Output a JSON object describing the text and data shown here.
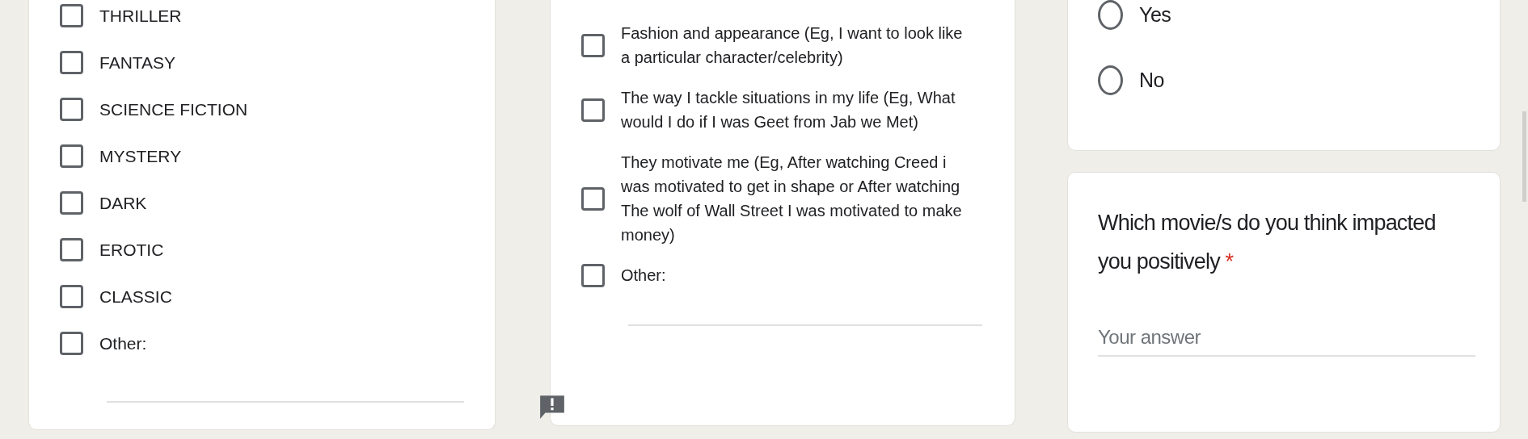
{
  "genre_question": {
    "options": [
      {
        "label": "THRILLER",
        "checked": false
      },
      {
        "label": "FANTASY",
        "checked": false
      },
      {
        "label": "SCIENCE FICTION",
        "checked": false
      },
      {
        "label": "MYSTERY",
        "checked": false
      },
      {
        "label": "DARK",
        "checked": false
      },
      {
        "label": "EROTIC",
        "checked": false
      },
      {
        "label": "CLASSIC",
        "checked": false
      },
      {
        "label": "Other:",
        "checked": false
      }
    ]
  },
  "impact_question": {
    "options": [
      {
        "label": "Fashion and appearance (Eg, I want to look like a particular character/celebrity)",
        "checked": false
      },
      {
        "label": "The way I tackle situations in my life (Eg, What would I do if I was Geet from Jab we Met)",
        "checked": false
      },
      {
        "label": "They motivate me (Eg, After watching Creed i was motivated to get in shape or After watching The wolf of Wall Street I was motivated to make money)",
        "checked": false
      },
      {
        "label": "Other:",
        "checked": false
      }
    ]
  },
  "yes_no_question": {
    "options": [
      {
        "label": "Yes",
        "selected": false
      },
      {
        "label": "No",
        "selected": false
      }
    ]
  },
  "movie_question": {
    "title": "Which movie/s do you think impacted you positively",
    "required_mark": "*",
    "placeholder": "Your answer"
  }
}
